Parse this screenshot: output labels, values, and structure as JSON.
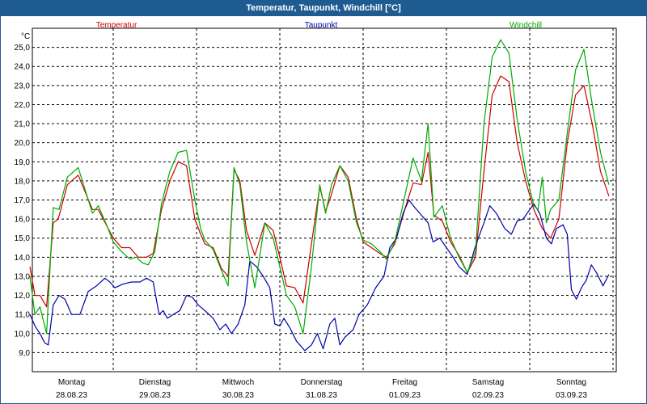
{
  "window": {
    "title": "Temperatur, Taupunkt, Windchill [°C]"
  },
  "colors": {
    "temperature": "#cc0000",
    "dewpoint": "#0000aa",
    "windchill": "#00aa00",
    "grid": "#000000"
  },
  "chart_data": {
    "type": "line",
    "title": "Temperatur, Taupunkt, Windchill [°C]",
    "ylabel": "°C",
    "ylim": [
      8.0,
      26.0
    ],
    "yticks": [
      "9,0",
      "10,0",
      "11,0",
      "12,0",
      "13,0",
      "14,0",
      "15,0",
      "16,0",
      "17,0",
      "18,0",
      "19,0",
      "20,0",
      "21,0",
      "22,0",
      "23,0",
      "24,0",
      "25,0"
    ],
    "xlim": [
      0,
      7
    ],
    "day_labels": [
      {
        "day": "Montag",
        "date": "28.08.23"
      },
      {
        "day": "Dienstag",
        "date": "29.08.23"
      },
      {
        "day": "Mittwoch",
        "date": "30.08.23"
      },
      {
        "day": "Donnerstag",
        "date": "31.08.23"
      },
      {
        "day": "Freitag",
        "date": "01.09.23"
      },
      {
        "day": "Samstag",
        "date": "02.09.23"
      },
      {
        "day": "Sonntag",
        "date": "03.09.23"
      }
    ],
    "grid": true,
    "legend_position": "top",
    "series": [
      {
        "name": "Temperatur",
        "points": [
          [
            0.0,
            13.5
          ],
          [
            0.06,
            12.0
          ],
          [
            0.12,
            12.0
          ],
          [
            0.2,
            11.4
          ],
          [
            0.28,
            15.8
          ],
          [
            0.34,
            16.0
          ],
          [
            0.45,
            17.8
          ],
          [
            0.58,
            18.3
          ],
          [
            0.75,
            16.5
          ],
          [
            0.82,
            16.5
          ],
          [
            1.0,
            15.0
          ],
          [
            1.1,
            14.5
          ],
          [
            1.2,
            14.5
          ],
          [
            1.3,
            14.0
          ],
          [
            1.4,
            14.0
          ],
          [
            1.48,
            14.2
          ],
          [
            1.58,
            16.5
          ],
          [
            1.68,
            18.0
          ],
          [
            1.78,
            19.0
          ],
          [
            1.88,
            18.8
          ],
          [
            1.98,
            16.0
          ],
          [
            2.05,
            15.2
          ],
          [
            2.1,
            14.7
          ],
          [
            2.2,
            14.5
          ],
          [
            2.3,
            13.4
          ],
          [
            2.38,
            13.0
          ],
          [
            2.45,
            18.6
          ],
          [
            2.52,
            18.0
          ],
          [
            2.6,
            15.4
          ],
          [
            2.7,
            14.1
          ],
          [
            2.82,
            15.8
          ],
          [
            2.92,
            15.4
          ],
          [
            3.0,
            14.0
          ],
          [
            3.08,
            12.5
          ],
          [
            3.18,
            12.4
          ],
          [
            3.28,
            11.6
          ],
          [
            3.38,
            14.7
          ],
          [
            3.48,
            17.7
          ],
          [
            3.55,
            16.4
          ],
          [
            3.62,
            17.3
          ],
          [
            3.72,
            18.8
          ],
          [
            3.82,
            18.2
          ],
          [
            3.92,
            16.0
          ],
          [
            4.0,
            14.8
          ],
          [
            4.1,
            14.5
          ],
          [
            4.2,
            14.2
          ],
          [
            4.28,
            14.0
          ],
          [
            4.38,
            14.7
          ],
          [
            4.5,
            16.5
          ],
          [
            4.6,
            17.9
          ],
          [
            4.7,
            17.8
          ],
          [
            4.78,
            19.5
          ],
          [
            4.85,
            16.2
          ],
          [
            4.95,
            15.9
          ],
          [
            5.05,
            14.8
          ],
          [
            5.15,
            14.1
          ],
          [
            5.25,
            13.2
          ],
          [
            5.35,
            14.0
          ],
          [
            5.45,
            18.5
          ],
          [
            5.55,
            22.5
          ],
          [
            5.65,
            23.5
          ],
          [
            5.75,
            23.2
          ],
          [
            5.85,
            20.0
          ],
          [
            5.95,
            18.0
          ],
          [
            6.05,
            16.5
          ],
          [
            6.15,
            15.5
          ],
          [
            6.25,
            15.0
          ],
          [
            6.35,
            16.0
          ],
          [
            6.45,
            20.0
          ],
          [
            6.55,
            22.5
          ],
          [
            6.65,
            23.0
          ],
          [
            6.75,
            21.0
          ],
          [
            6.85,
            18.5
          ],
          [
            6.95,
            17.2
          ]
        ]
      },
      {
        "name": "Taupunkt",
        "points": [
          [
            0.0,
            11.0
          ],
          [
            0.06,
            10.4
          ],
          [
            0.12,
            10.0
          ],
          [
            0.18,
            9.5
          ],
          [
            0.22,
            9.4
          ],
          [
            0.28,
            11.5
          ],
          [
            0.35,
            12.0
          ],
          [
            0.42,
            11.8
          ],
          [
            0.5,
            11.0
          ],
          [
            0.6,
            11.0
          ],
          [
            0.7,
            12.2
          ],
          [
            0.8,
            12.5
          ],
          [
            0.9,
            12.9
          ],
          [
            0.96,
            12.7
          ],
          [
            1.02,
            12.4
          ],
          [
            1.12,
            12.6
          ],
          [
            1.22,
            12.7
          ],
          [
            1.32,
            12.7
          ],
          [
            1.4,
            12.9
          ],
          [
            1.48,
            12.7
          ],
          [
            1.55,
            11.0
          ],
          [
            1.6,
            11.2
          ],
          [
            1.65,
            10.8
          ],
          [
            1.72,
            11.0
          ],
          [
            1.8,
            11.2
          ],
          [
            1.88,
            12.0
          ],
          [
            1.95,
            11.9
          ],
          [
            2.02,
            11.5
          ],
          [
            2.1,
            11.2
          ],
          [
            2.2,
            10.8
          ],
          [
            2.28,
            10.2
          ],
          [
            2.35,
            10.5
          ],
          [
            2.42,
            10.0
          ],
          [
            2.5,
            10.5
          ],
          [
            2.58,
            11.5
          ],
          [
            2.64,
            13.8
          ],
          [
            2.72,
            13.5
          ],
          [
            2.8,
            13.0
          ],
          [
            2.88,
            12.4
          ],
          [
            2.94,
            10.5
          ],
          [
            3.0,
            10.4
          ],
          [
            3.05,
            10.8
          ],
          [
            3.12,
            10.3
          ],
          [
            3.2,
            9.6
          ],
          [
            3.3,
            9.1
          ],
          [
            3.38,
            9.4
          ],
          [
            3.45,
            10.0
          ],
          [
            3.52,
            9.2
          ],
          [
            3.6,
            10.5
          ],
          [
            3.66,
            10.8
          ],
          [
            3.72,
            9.4
          ],
          [
            3.78,
            9.8
          ],
          [
            3.88,
            10.2
          ],
          [
            3.95,
            11.0
          ],
          [
            4.05,
            11.5
          ],
          [
            4.15,
            12.4
          ],
          [
            4.25,
            13.0
          ],
          [
            4.32,
            14.5
          ],
          [
            4.4,
            15.0
          ],
          [
            4.48,
            16.3
          ],
          [
            4.55,
            17.0
          ],
          [
            4.62,
            16.6
          ],
          [
            4.7,
            16.2
          ],
          [
            4.78,
            15.8
          ],
          [
            4.84,
            14.8
          ],
          [
            4.92,
            15.0
          ],
          [
            5.0,
            14.5
          ],
          [
            5.08,
            14.0
          ],
          [
            5.15,
            13.5
          ],
          [
            5.25,
            13.1
          ],
          [
            5.35,
            14.6
          ],
          [
            5.45,
            15.8
          ],
          [
            5.52,
            16.7
          ],
          [
            5.6,
            16.3
          ],
          [
            5.7,
            15.5
          ],
          [
            5.78,
            15.2
          ],
          [
            5.85,
            15.9
          ],
          [
            5.92,
            16.0
          ],
          [
            6.0,
            16.5
          ],
          [
            6.05,
            16.8
          ],
          [
            6.12,
            16.3
          ],
          [
            6.2,
            15.0
          ],
          [
            6.26,
            14.7
          ],
          [
            6.32,
            15.5
          ],
          [
            6.4,
            15.7
          ],
          [
            6.45,
            15.2
          ],
          [
            6.5,
            12.3
          ],
          [
            6.56,
            11.8
          ],
          [
            6.62,
            12.4
          ],
          [
            6.68,
            12.8
          ],
          [
            6.74,
            13.6
          ],
          [
            6.8,
            13.2
          ],
          [
            6.88,
            12.5
          ],
          [
            6.95,
            13.1
          ]
        ]
      },
      {
        "name": "Windchill",
        "points": [
          [
            0.0,
            13.0
          ],
          [
            0.06,
            11.0
          ],
          [
            0.12,
            11.4
          ],
          [
            0.2,
            10.0
          ],
          [
            0.28,
            16.6
          ],
          [
            0.35,
            16.5
          ],
          [
            0.45,
            18.2
          ],
          [
            0.58,
            18.7
          ],
          [
            0.75,
            16.3
          ],
          [
            0.82,
            16.7
          ],
          [
            0.92,
            15.7
          ],
          [
            1.0,
            14.8
          ],
          [
            1.1,
            14.3
          ],
          [
            1.2,
            13.9
          ],
          [
            1.28,
            14.0
          ],
          [
            1.35,
            13.7
          ],
          [
            1.42,
            13.6
          ],
          [
            1.5,
            14.3
          ],
          [
            1.58,
            16.8
          ],
          [
            1.68,
            18.5
          ],
          [
            1.78,
            19.5
          ],
          [
            1.88,
            19.6
          ],
          [
            1.98,
            17.0
          ],
          [
            2.05,
            15.5
          ],
          [
            2.1,
            14.9
          ],
          [
            2.2,
            14.4
          ],
          [
            2.3,
            13.3
          ],
          [
            2.38,
            12.5
          ],
          [
            2.45,
            18.7
          ],
          [
            2.52,
            17.8
          ],
          [
            2.6,
            14.8
          ],
          [
            2.7,
            12.4
          ],
          [
            2.82,
            15.8
          ],
          [
            2.92,
            15.0
          ],
          [
            3.0,
            13.5
          ],
          [
            3.08,
            12.0
          ],
          [
            3.18,
            11.4
          ],
          [
            3.28,
            10.0
          ],
          [
            3.38,
            13.5
          ],
          [
            3.48,
            17.8
          ],
          [
            3.55,
            16.3
          ],
          [
            3.62,
            17.8
          ],
          [
            3.72,
            18.8
          ],
          [
            3.82,
            18.0
          ],
          [
            3.92,
            15.8
          ],
          [
            4.0,
            14.9
          ],
          [
            4.1,
            14.7
          ],
          [
            4.2,
            14.3
          ],
          [
            4.28,
            13.9
          ],
          [
            4.38,
            14.8
          ],
          [
            4.5,
            17.2
          ],
          [
            4.6,
            19.2
          ],
          [
            4.7,
            18.0
          ],
          [
            4.78,
            21.0
          ],
          [
            4.85,
            16.1
          ],
          [
            4.95,
            16.7
          ],
          [
            5.05,
            15.0
          ],
          [
            5.15,
            14.0
          ],
          [
            5.25,
            13.2
          ],
          [
            5.35,
            14.3
          ],
          [
            5.45,
            21.0
          ],
          [
            5.55,
            24.5
          ],
          [
            5.65,
            25.4
          ],
          [
            5.75,
            24.7
          ],
          [
            5.85,
            21.2
          ],
          [
            5.95,
            18.5
          ],
          [
            6.05,
            16.7
          ],
          [
            6.1,
            16.5
          ],
          [
            6.15,
            18.2
          ],
          [
            6.2,
            15.8
          ],
          [
            6.25,
            16.5
          ],
          [
            6.35,
            17.0
          ],
          [
            6.45,
            20.5
          ],
          [
            6.55,
            23.8
          ],
          [
            6.65,
            24.9
          ],
          [
            6.75,
            22.0
          ],
          [
            6.85,
            19.5
          ],
          [
            6.95,
            17.8
          ]
        ]
      }
    ]
  }
}
